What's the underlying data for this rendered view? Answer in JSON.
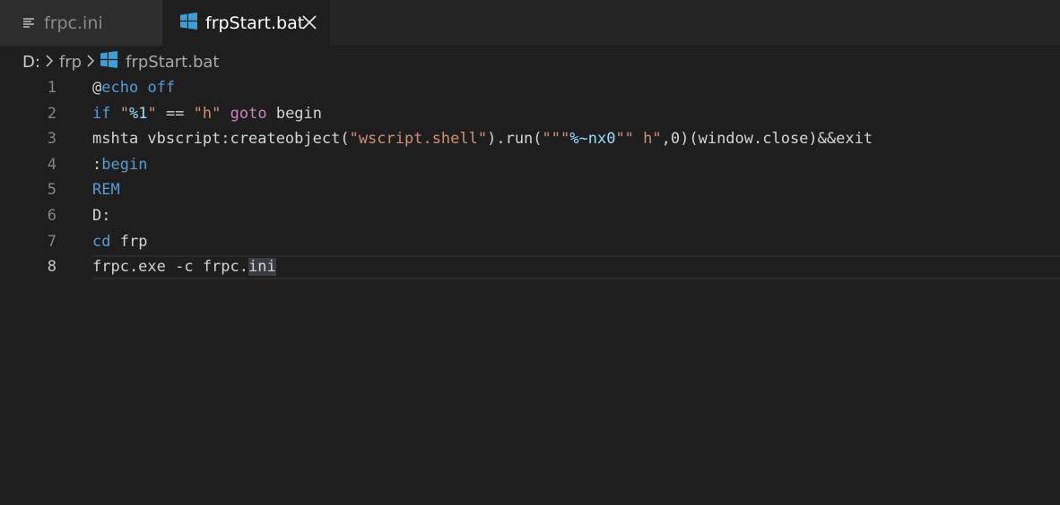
{
  "tabs": [
    {
      "label": "frpc.ini",
      "icon": "lines-icon",
      "active": false
    },
    {
      "label": "frpStart.bat",
      "icon": "windows-icon",
      "active": true,
      "close_icon": "close-icon"
    }
  ],
  "breadcrumb": {
    "items": [
      "D:",
      "frp",
      "frpStart.bat"
    ],
    "separator_icon": "chevron-right-icon",
    "file_icon": "windows-icon"
  },
  "colors": {
    "editor_background": "#1e1e1e",
    "keyword": "#569cd6",
    "control": "#c586c0",
    "string": "#ce9178",
    "variable": "#9cdcfe",
    "windows_icon": "#3c9fd6"
  },
  "editor": {
    "current_line": 8,
    "lines": [
      {
        "number": "1",
        "tokens": [
          {
            "text": "@",
            "kind": "plain"
          },
          {
            "text": "echo",
            "kind": "kw"
          },
          {
            "text": " ",
            "kind": "plain"
          },
          {
            "text": "off",
            "kind": "kw"
          }
        ]
      },
      {
        "number": "2",
        "tokens": [
          {
            "text": "if",
            "kind": "kw"
          },
          {
            "text": " ",
            "kind": "plain"
          },
          {
            "text": "\"",
            "kind": "str"
          },
          {
            "text": "%1",
            "kind": "var"
          },
          {
            "text": "\"",
            "kind": "str"
          },
          {
            "text": " == ",
            "kind": "plain"
          },
          {
            "text": "\"h\"",
            "kind": "str"
          },
          {
            "text": " ",
            "kind": "plain"
          },
          {
            "text": "goto",
            "kind": "ctl"
          },
          {
            "text": " begin",
            "kind": "plain"
          }
        ]
      },
      {
        "number": "3",
        "tokens": [
          {
            "text": "mshta vbscript:createobject(",
            "kind": "plain"
          },
          {
            "text": "\"wscript.shell\"",
            "kind": "str"
          },
          {
            "text": ").run(",
            "kind": "plain"
          },
          {
            "text": "\"\"\"",
            "kind": "str"
          },
          {
            "text": "%~nx0",
            "kind": "var"
          },
          {
            "text": "\"\"",
            "kind": "str"
          },
          {
            "text": " h",
            "kind": "str"
          },
          {
            "text": "\"",
            "kind": "str"
          },
          {
            "text": ",0)(window.close)&&exit",
            "kind": "plain"
          }
        ]
      },
      {
        "number": "4",
        "tokens": [
          {
            "text": ":",
            "kind": "plain"
          },
          {
            "text": "begin",
            "kind": "kw"
          }
        ]
      },
      {
        "number": "5",
        "tokens": [
          {
            "text": "REM",
            "kind": "kw"
          }
        ]
      },
      {
        "number": "6",
        "tokens": [
          {
            "text": "D:",
            "kind": "plain"
          }
        ]
      },
      {
        "number": "7",
        "tokens": [
          {
            "text": "cd",
            "kind": "kw"
          },
          {
            "text": " frp",
            "kind": "plain"
          }
        ]
      },
      {
        "number": "8",
        "tokens": [
          {
            "text": "frpc.exe -c frpc.",
            "kind": "plain"
          },
          {
            "text": "ini",
            "kind": "sel"
          }
        ]
      }
    ]
  }
}
